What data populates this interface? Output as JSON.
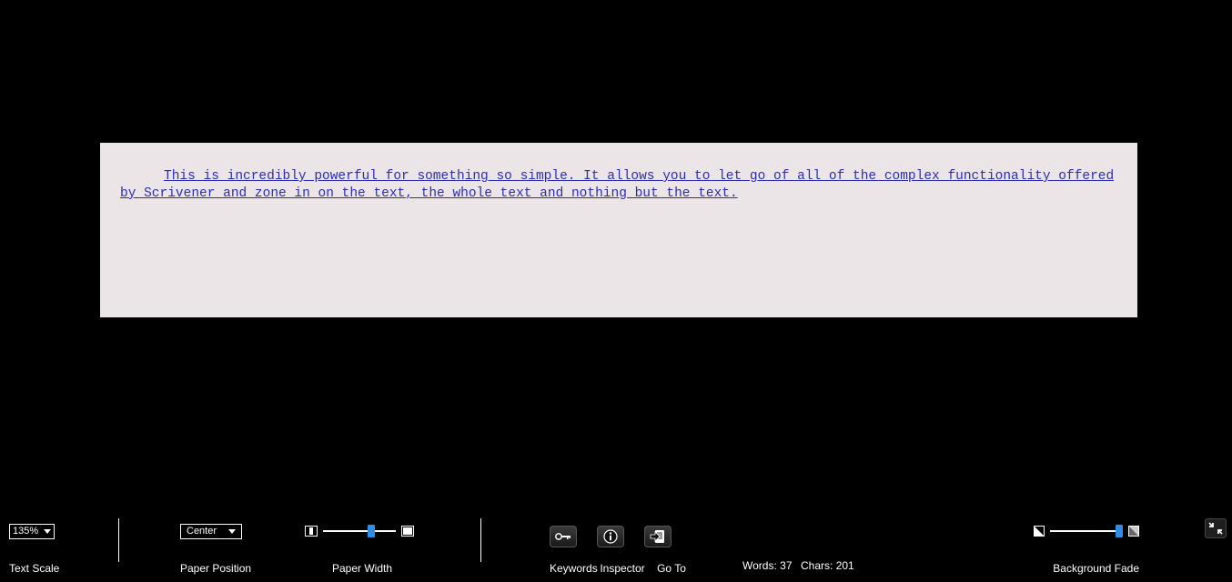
{
  "editor": {
    "text": "This is incredibly powerful for something so simple. It allows you to let go of all of the complex functionality offered by Scrivener and zone in on the text, the whole text and nothing but the text. "
  },
  "footer": {
    "text_scale": {
      "label": "Text Scale",
      "value": "135%"
    },
    "paper_position": {
      "label": "Paper Position",
      "value": "Center"
    },
    "paper_width": {
      "label": "Paper Width",
      "slider_pct": 65
    },
    "icon_labels": {
      "keywords": "Keywords",
      "inspector": "Inspector",
      "goto": "Go To"
    },
    "stats": {
      "words_label": "Words:",
      "words_value": "37",
      "chars_label": "Chars:",
      "chars_value": "201"
    },
    "background_fade": {
      "label": "Background Fade",
      "slider_pct": 95
    }
  }
}
